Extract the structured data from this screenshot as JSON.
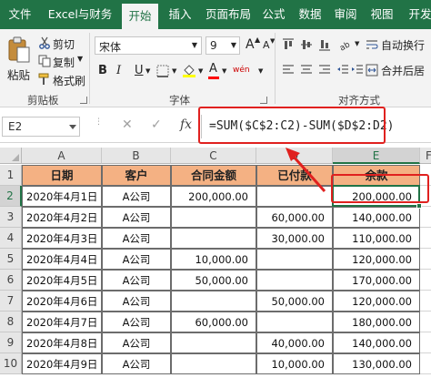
{
  "ribbon_tabs": [
    {
      "label": "文件",
      "active": false
    },
    {
      "label": "Excel与财务",
      "active": false
    },
    {
      "label": "开始",
      "active": true
    },
    {
      "label": "插入",
      "active": false
    },
    {
      "label": "页面布局",
      "active": false
    },
    {
      "label": "公式",
      "active": false
    },
    {
      "label": "数据",
      "active": false
    },
    {
      "label": "审阅",
      "active": false
    },
    {
      "label": "视图",
      "active": false
    },
    {
      "label": "开发",
      "active": false
    }
  ],
  "clipboard": {
    "paste_label": "粘贴",
    "cut_label": "剪切",
    "copy_label": "复制",
    "format_painter_label": "格式刷",
    "group_label": "剪贴板"
  },
  "font": {
    "font_name": "宋体",
    "font_size": "9",
    "grow_label": "A",
    "shrink_label": "A",
    "bold_label": "B",
    "italic_label": "I",
    "underline_label": "U",
    "phonetic_label": "wén",
    "color_label": "A",
    "group_label": "字体"
  },
  "alignment": {
    "wrap_text_label": "自动换行",
    "merge_center_label": "合并后居",
    "group_label": "对齐方式"
  },
  "formula_bar": {
    "name_box": "E2",
    "cancel_symbol": "✕",
    "enter_symbol": "✓",
    "fx_label": "fx",
    "formula": "=SUM($C$2:C2)-SUM($D$2:D2)"
  },
  "sheet": {
    "column_headers": [
      "A",
      "B",
      "C",
      "D",
      "E",
      "F"
    ],
    "row_numbers": [
      "1",
      "2",
      "3",
      "4",
      "5",
      "6",
      "7",
      "8",
      "9",
      "10"
    ],
    "selected_column": "E",
    "selected_row": "2",
    "header_row": [
      "日期",
      "客户",
      "合同金额",
      "已付款",
      "余款"
    ],
    "rows": [
      [
        "2020年4月1日",
        "A公司",
        "200,000.00",
        "",
        "200,000.00"
      ],
      [
        "2020年4月2日",
        "A公司",
        "",
        "60,000.00",
        "140,000.00"
      ],
      [
        "2020年4月3日",
        "A公司",
        "",
        "30,000.00",
        "110,000.00"
      ],
      [
        "2020年4月4日",
        "A公司",
        "10,000.00",
        "",
        "120,000.00"
      ],
      [
        "2020年4月5日",
        "A公司",
        "50,000.00",
        "",
        "170,000.00"
      ],
      [
        "2020年4月6日",
        "A公司",
        "",
        "50,000.00",
        "120,000.00"
      ],
      [
        "2020年4月7日",
        "A公司",
        "60,000.00",
        "",
        "180,000.00"
      ],
      [
        "2020年4月8日",
        "A公司",
        "",
        "40,000.00",
        "140,000.00"
      ],
      [
        "2020年4月9日",
        "A公司",
        "",
        "10,000.00",
        "130,000.00"
      ]
    ]
  },
  "colors": {
    "ribbon_green": "#217346",
    "header_fill": "#f4b183",
    "highlight_red": "#e0211f"
  }
}
